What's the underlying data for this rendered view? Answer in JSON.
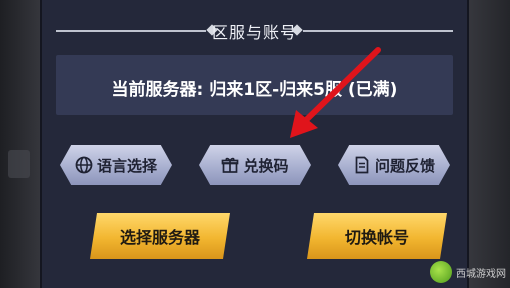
{
  "dialog": {
    "title": "区服与账号",
    "current_server_text": "当前服务器: 归来1区-归来5服 (已满)"
  },
  "buttons_row1": [
    {
      "label": "语言选择",
      "icon": "globe-icon"
    },
    {
      "label": "兑换码",
      "icon": "gift-icon"
    },
    {
      "label": "问题反馈",
      "icon": "document-icon"
    }
  ],
  "buttons_row2": [
    {
      "label": "选择服务器"
    },
    {
      "label": "切换帐号"
    }
  ],
  "annotation": {
    "arrow_color": "#e0141b"
  },
  "watermark": {
    "text": "西城游戏网"
  }
}
